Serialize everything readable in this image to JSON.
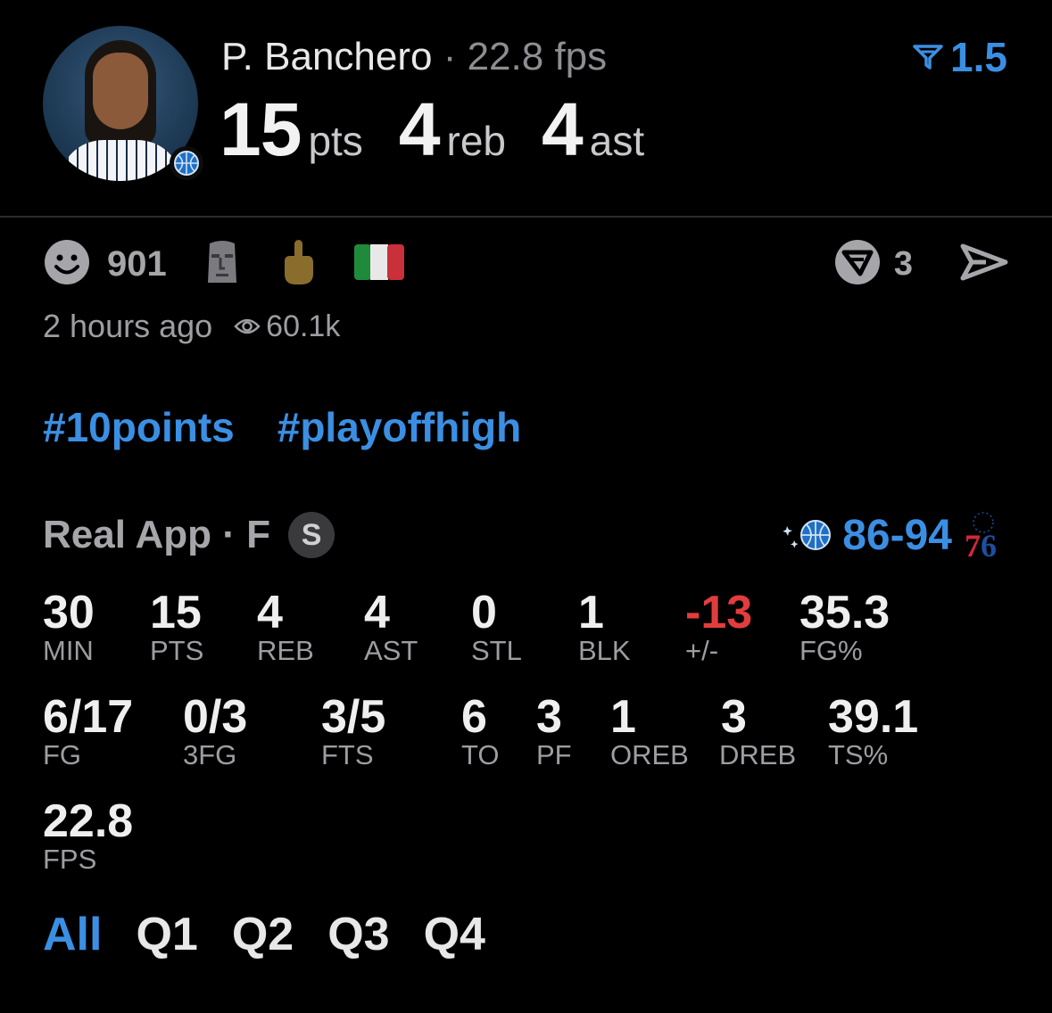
{
  "player": {
    "name": "P. Banchero",
    "fps_inline": " · 22.8 fps",
    "odds": "1.5"
  },
  "headline": [
    {
      "value": "15",
      "unit": "pts"
    },
    {
      "value": "4",
      "unit": "reb"
    },
    {
      "value": "4",
      "unit": "ast"
    }
  ],
  "reactions": {
    "count": "901",
    "comments": "3"
  },
  "meta": {
    "posted": "2 hours ago",
    "views": "60.1k"
  },
  "tags": [
    "#10points",
    "#playoffhigh"
  ],
  "source": {
    "label": "Real App · F",
    "badge": "S",
    "score": "86-94"
  },
  "stats_row1": [
    {
      "value": "30",
      "label": "MIN"
    },
    {
      "value": "15",
      "label": "PTS"
    },
    {
      "value": "4",
      "label": "REB"
    },
    {
      "value": "4",
      "label": "AST"
    },
    {
      "value": "0",
      "label": "STL"
    },
    {
      "value": "1",
      "label": "BLK"
    },
    {
      "value": "-13",
      "label": "+/-"
    },
    {
      "value": "35.3",
      "label": "FG%"
    }
  ],
  "stats_row2": [
    {
      "value": "6/17",
      "label": "FG"
    },
    {
      "value": "0/3",
      "label": "3FG"
    },
    {
      "value": "3/5",
      "label": "FTS"
    },
    {
      "value": "6",
      "label": "TO"
    },
    {
      "value": "3",
      "label": "PF"
    },
    {
      "value": "1",
      "label": "OREB"
    },
    {
      "value": "3",
      "label": "DREB"
    },
    {
      "value": "39.1",
      "label": "TS%"
    }
  ],
  "stats_row3": [
    {
      "value": "22.8",
      "label": "FPS"
    }
  ],
  "quarters": [
    "All",
    "Q1",
    "Q2",
    "Q3",
    "Q4"
  ],
  "colors": {
    "accent": "#3b8fe3",
    "negative": "#e23d3d"
  }
}
